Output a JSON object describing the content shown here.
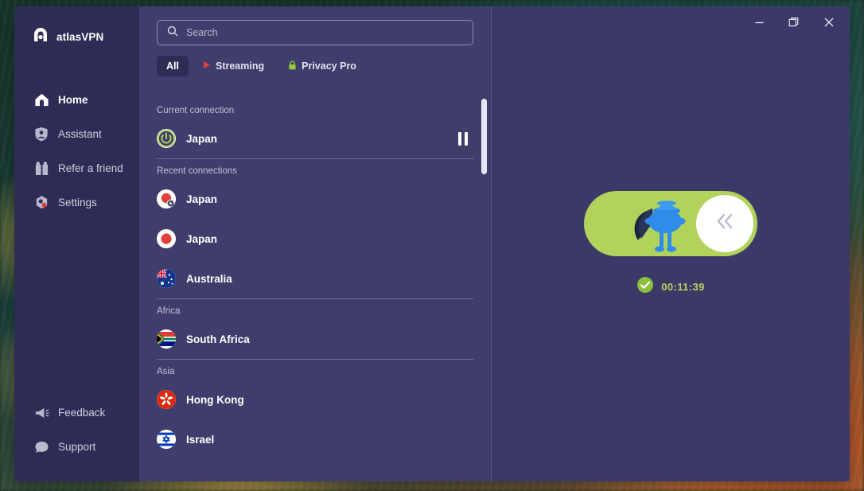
{
  "window": {
    "title": "atlasVPN",
    "controls": [
      {
        "name": "minimize",
        "glyph": "–"
      },
      {
        "name": "restore",
        "glyph": "❐"
      },
      {
        "name": "close",
        "glyph": "✕"
      }
    ]
  },
  "sidebar": {
    "brand": "atlasVPN",
    "items": [
      {
        "label": "Home",
        "icon": "home-icon",
        "active": true
      },
      {
        "label": "Assistant",
        "icon": "shield-user-icon",
        "active": false
      },
      {
        "label": "Refer a friend",
        "icon": "gift-icon",
        "active": false
      },
      {
        "label": "Settings",
        "icon": "gear-icon",
        "active": false
      }
    ],
    "bottom_items": [
      {
        "label": "Feedback",
        "icon": "megaphone-icon"
      },
      {
        "label": "Support",
        "icon": "chat-bubble-icon"
      }
    ]
  },
  "search": {
    "placeholder": "Search",
    "value": "",
    "icon": "search-icon"
  },
  "tabs": [
    {
      "label": "All",
      "icon": "",
      "active": true
    },
    {
      "label": "Streaming",
      "icon": "play-icon",
      "active": false
    },
    {
      "label": "Privacy Pro",
      "icon": "lock-icon",
      "active": false
    }
  ],
  "server_list": {
    "sections": [
      {
        "label": "Current connection",
        "rows": [
          {
            "name": "Japan",
            "flag": "jp",
            "badge": "streaming-badge",
            "action": "pause-button"
          }
        ]
      },
      {
        "label": "Recent connections",
        "rows": [
          {
            "name": "Japan",
            "flag": "jp",
            "badge": "streaming-badge",
            "action": ""
          },
          {
            "name": "Japan",
            "flag": "jp",
            "badge": "",
            "action": ""
          },
          {
            "name": "Australia",
            "flag": "au",
            "badge": "",
            "action": ""
          }
        ]
      },
      {
        "label": "Africa",
        "rows": [
          {
            "name": "South Africa",
            "flag": "za",
            "badge": "",
            "action": ""
          }
        ]
      },
      {
        "label": "Asia",
        "rows": [
          {
            "name": "Hong Kong",
            "flag": "hk",
            "badge": "",
            "action": ""
          },
          {
            "name": "Israel",
            "flag": "il",
            "badge": "",
            "action": ""
          }
        ]
      }
    ]
  },
  "connection": {
    "toggle_state": "on",
    "toggle_knob_icon": "double-chevron-left-icon",
    "mascot": "superhero-mascot",
    "status_icon": "check-circle-icon",
    "elapsed_time": "00:11:39"
  },
  "colors": {
    "sidebar_bg": "#2e2c54",
    "list_bg": "#3f3d6b",
    "panel_bg": "#3b3968",
    "accent_green": "#b2d25c",
    "accent_red": "#e23b3b",
    "timer_text": "#b9d45f"
  }
}
